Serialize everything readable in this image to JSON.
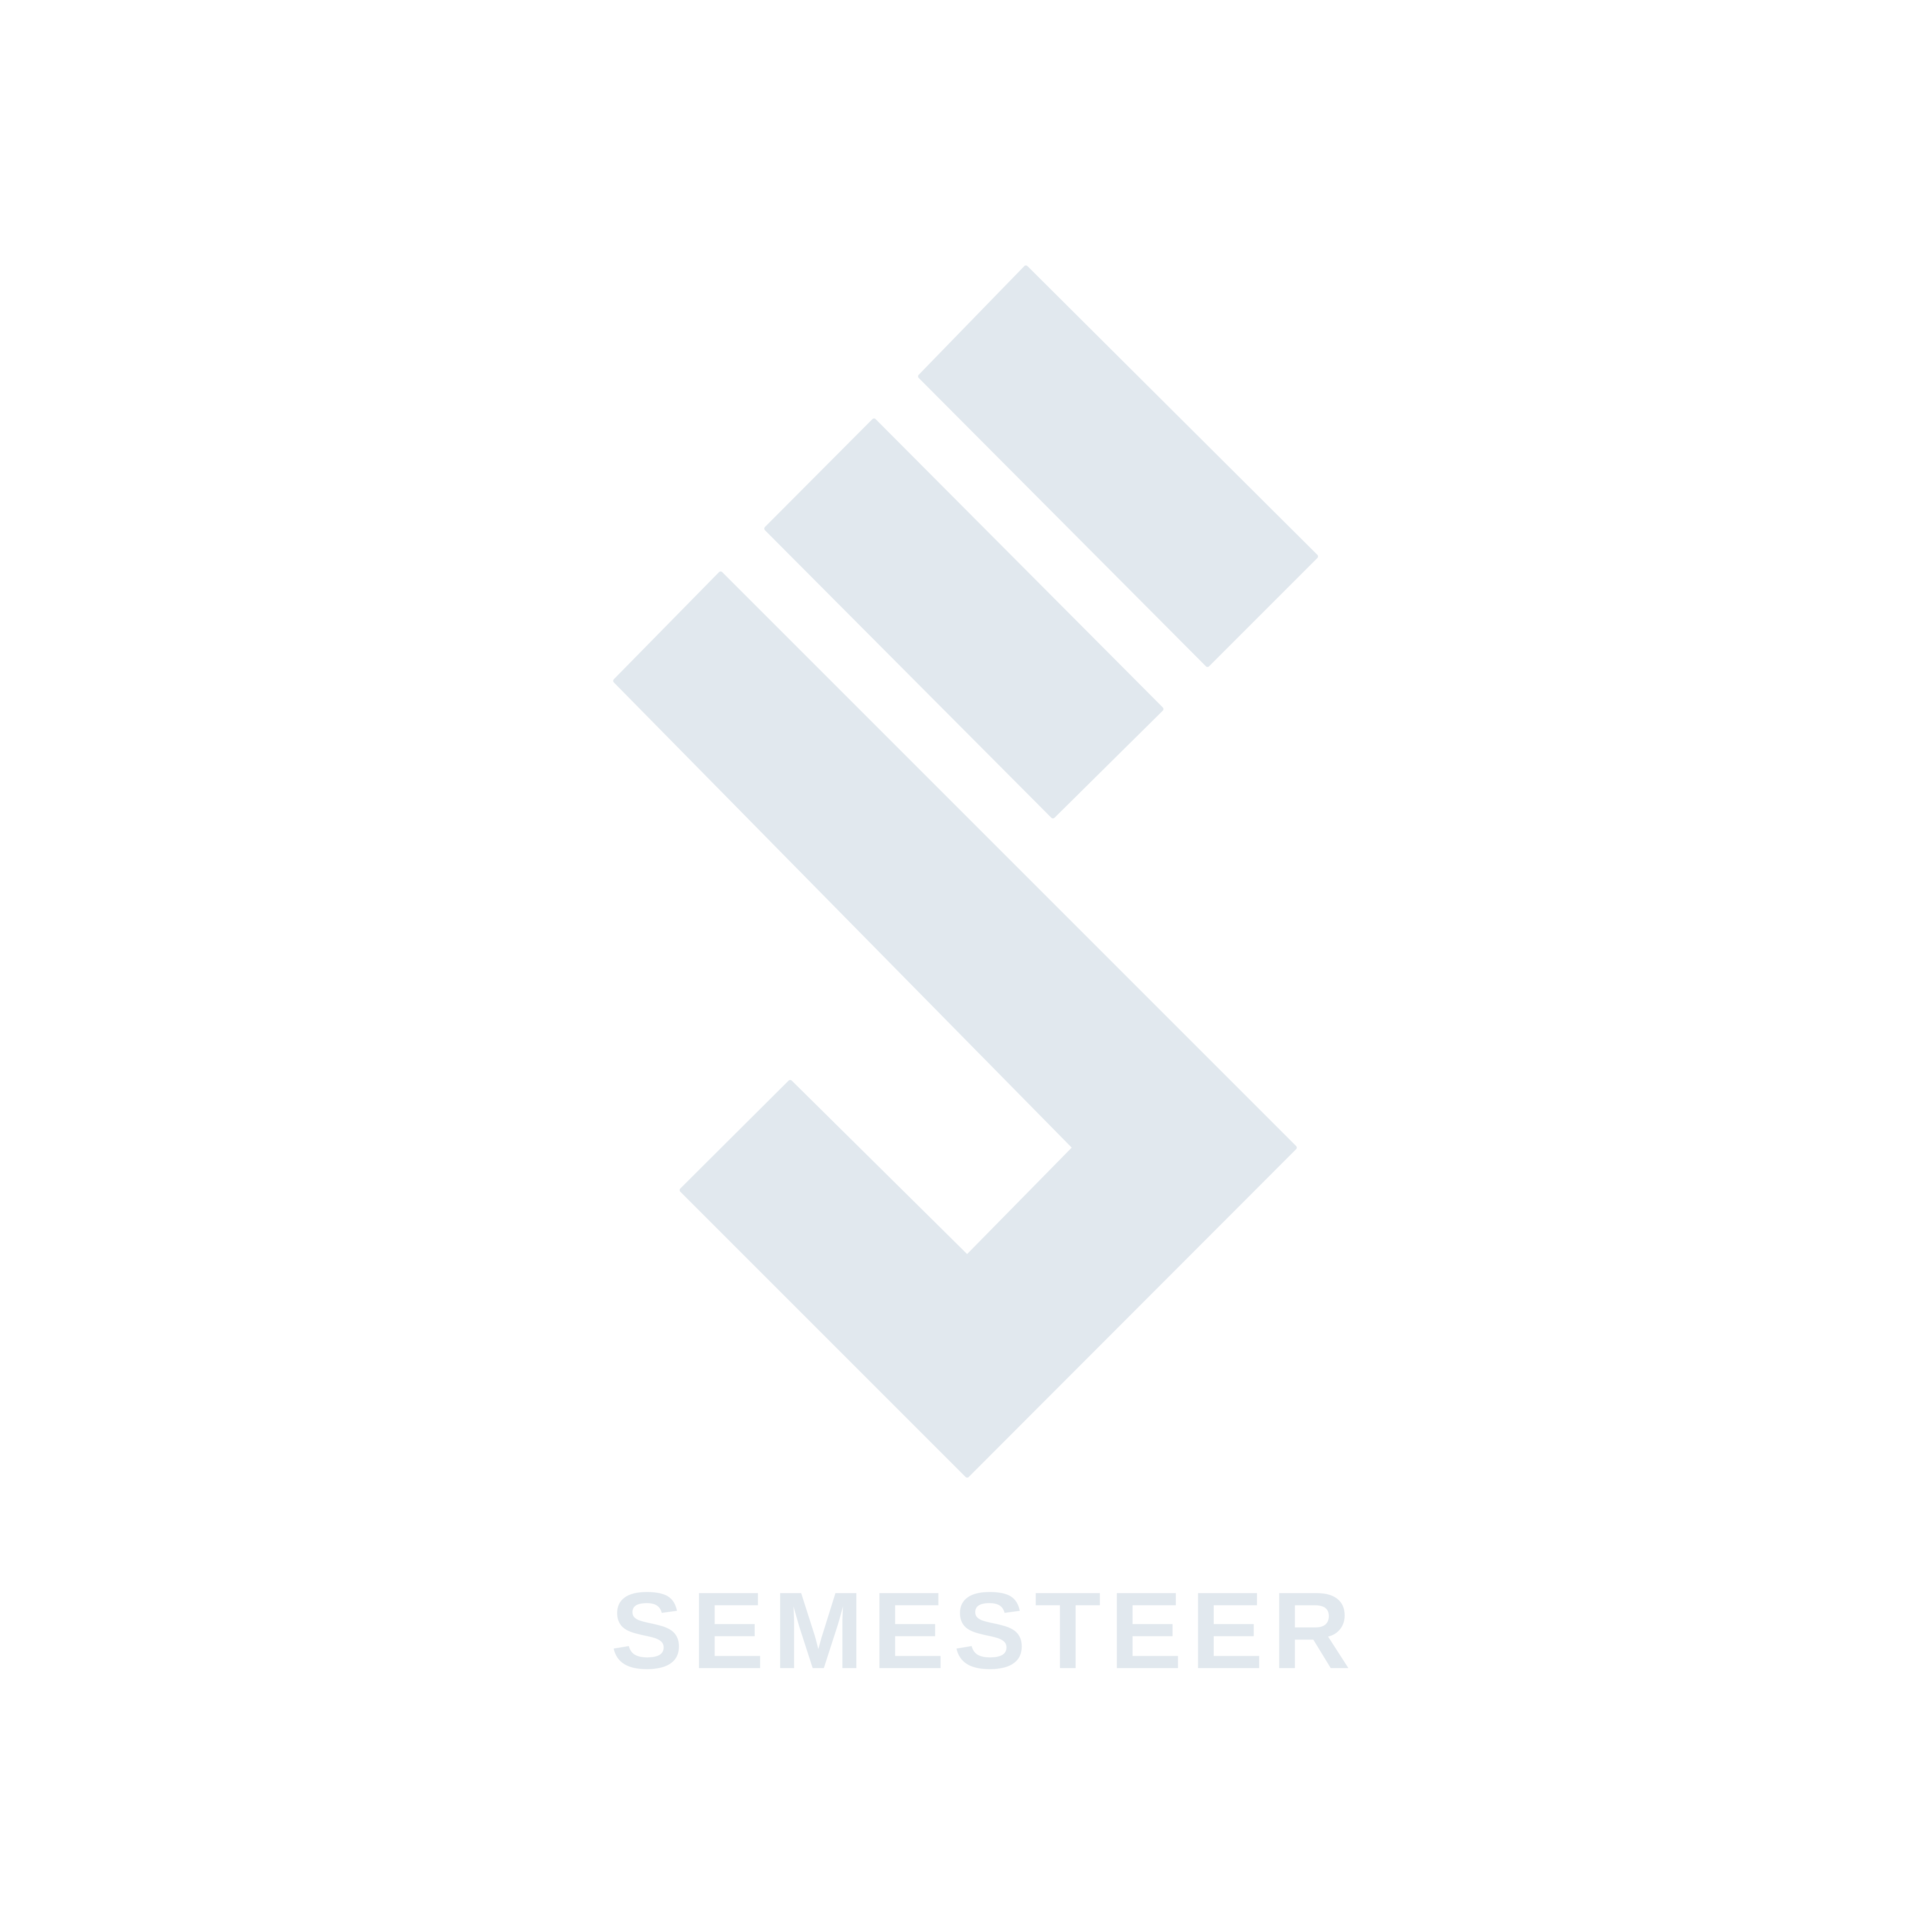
{
  "logo": {
    "wordmark": "SEMESTEER",
    "mark_icon": "stacked-diagonal-bars-s-mark",
    "color": "#e1e8ee",
    "background": "#ffffff"
  }
}
